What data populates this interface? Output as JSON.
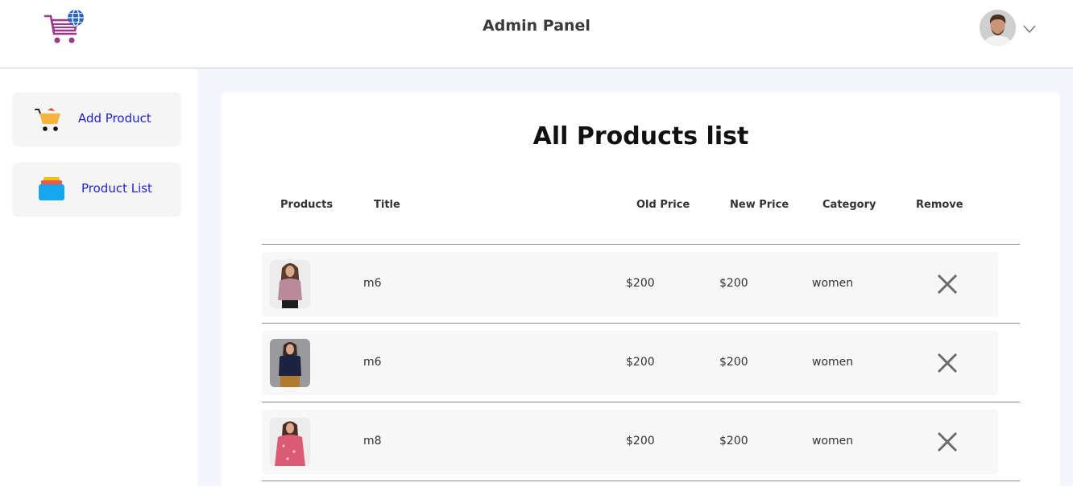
{
  "header": {
    "title": "Admin Panel",
    "logo_icon": "shopping-cart-globe-icon",
    "avatar_icon": "user-avatar",
    "dropdown_icon": "chevron-down-icon"
  },
  "sidebar": {
    "items": [
      {
        "label": "Add Product",
        "icon": "shopping-cart-icon"
      },
      {
        "label": "Product List",
        "icon": "stacked-list-icon"
      }
    ]
  },
  "main": {
    "title": "All Products list",
    "columns": [
      "Products",
      "Title",
      "Old Price",
      "New Price",
      "Category",
      "Remove"
    ],
    "rows": [
      {
        "title": "m6",
        "old_price": "$200",
        "new_price": "$200",
        "category": "women"
      },
      {
        "title": "m6",
        "old_price": "$200",
        "new_price": "$200",
        "category": "women"
      },
      {
        "title": "m8",
        "old_price": "$200",
        "new_price": "$200",
        "category": "women"
      }
    ]
  },
  "colors": {
    "accent_link": "#1f1fcf",
    "page_bg": "#f4f5fc",
    "row_bg": "#f7f7f7"
  }
}
